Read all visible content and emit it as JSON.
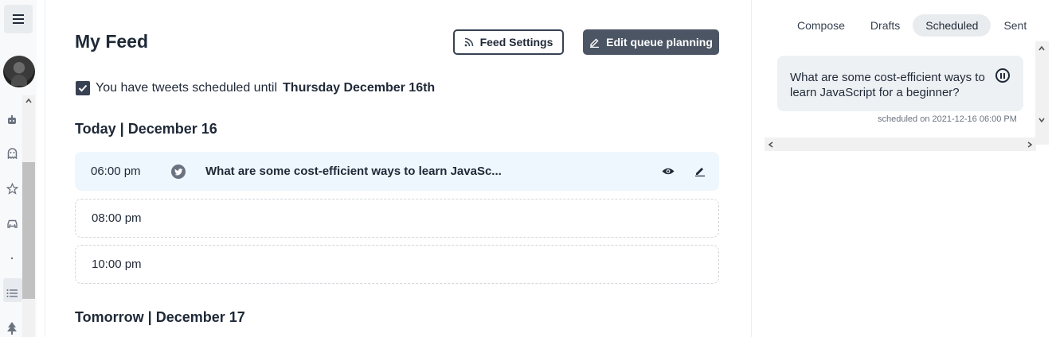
{
  "feed": {
    "title": "My Feed",
    "feed_settings_label": "Feed Settings",
    "edit_queue_label": "Edit queue planning",
    "scheduled_prefix": "You have tweets scheduled until",
    "scheduled_until": "Thursday December 16th",
    "days": [
      {
        "heading": "Today | December 16",
        "slots": [
          {
            "time": "06:00 pm",
            "text": "What are some cost-efficient ways to learn JavaSc..."
          },
          {
            "time": "08:00 pm"
          },
          {
            "time": "10:00 pm"
          }
        ]
      },
      {
        "heading": "Tomorrow | December 17"
      }
    ]
  },
  "panel": {
    "tabs": [
      {
        "label": "Compose",
        "active": false
      },
      {
        "label": "Drafts",
        "active": false
      },
      {
        "label": "Scheduled",
        "active": true
      },
      {
        "label": "Sent",
        "active": false
      }
    ],
    "card": {
      "text": "What are some cost-efficient ways to learn JavaScript for a beginner?",
      "meta": "scheduled on 2021-12-16 06:00 PM"
    }
  },
  "sidebar": {
    "icons": [
      "menu-icon",
      "robot-icon",
      "ghost-icon",
      "star-icon",
      "car-icon",
      "dot-icon",
      "list-icon",
      "tree-icon"
    ]
  },
  "colors": {
    "dark_button": "#4b5563",
    "slot_highlight": "#eef7fd",
    "active_tab": "#e9ecef"
  }
}
